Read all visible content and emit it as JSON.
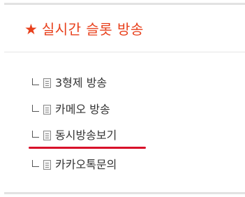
{
  "section": {
    "title": "실시간 슬롯 방송",
    "star_icon": "star-icon",
    "accent_color": "#e8401c"
  },
  "menu": {
    "items": [
      {
        "label": "3형제 방송",
        "icon": "document-icon"
      },
      {
        "label": "카메오 방송",
        "icon": "document-icon"
      },
      {
        "label": "동시방송보기",
        "icon": "document-icon"
      },
      {
        "label": "카카오톡문의",
        "icon": "document-icon"
      }
    ],
    "underline_color": "#d8102a"
  }
}
